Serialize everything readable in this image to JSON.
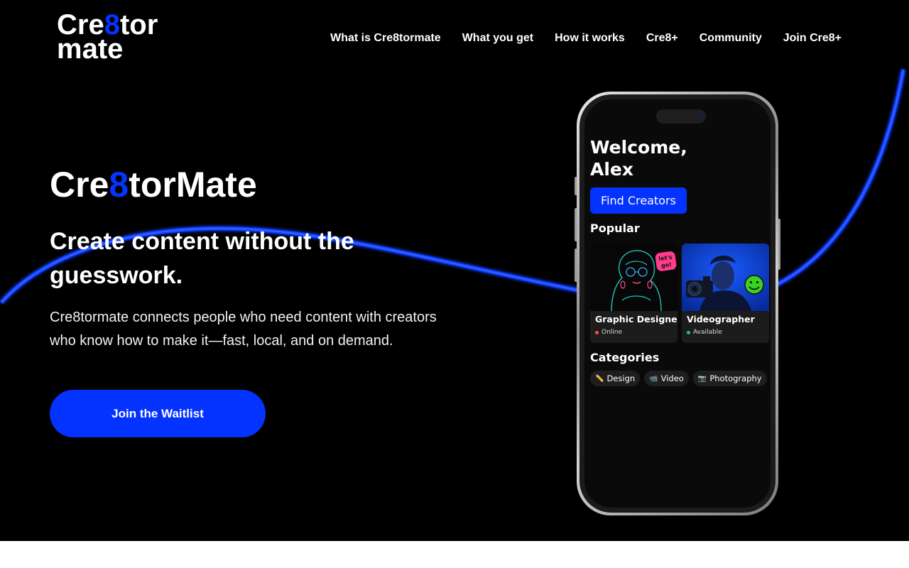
{
  "brand": {
    "logo_line1_a": "Cre",
    "logo_line1_b": "8",
    "logo_line1_c": "tor",
    "logo_line2": "mate"
  },
  "nav": [
    {
      "label": "What is Cre8tormate"
    },
    {
      "label": "What you get"
    },
    {
      "label": "How it works"
    },
    {
      "label": "Cre8+"
    },
    {
      "label": "Community"
    },
    {
      "label": "Join Cre8+"
    }
  ],
  "hero": {
    "title_a": "Cre",
    "title_b": "8",
    "title_c": "torMate",
    "headline": "Create content without the guesswork.",
    "description": "Cre8tormate connects people who need content with creators who know how to make it—fast, local, and on demand.",
    "cta_label": "Join the Waitlist"
  },
  "phone": {
    "welcome": "Welcome, Alex",
    "find_button": "Find Creators",
    "popular_title": "Popular",
    "cards": [
      {
        "title": "Graphic Designer",
        "status": "Online",
        "status_color": "#ff4d4d",
        "sticker": "let's go!"
      },
      {
        "title": "Videographer",
        "status": "Available",
        "status_color": "#22c55e"
      }
    ],
    "categories_title": "Categories",
    "categories": [
      {
        "icon": "pencil-icon",
        "glyph": "✏️",
        "label": "Design"
      },
      {
        "icon": "video-camera-icon",
        "glyph": "📹",
        "label": "Video"
      },
      {
        "icon": "camera-icon",
        "glyph": "📷",
        "label": "Photography"
      }
    ]
  },
  "colors": {
    "accent": "#0433ff",
    "background": "#000000"
  }
}
